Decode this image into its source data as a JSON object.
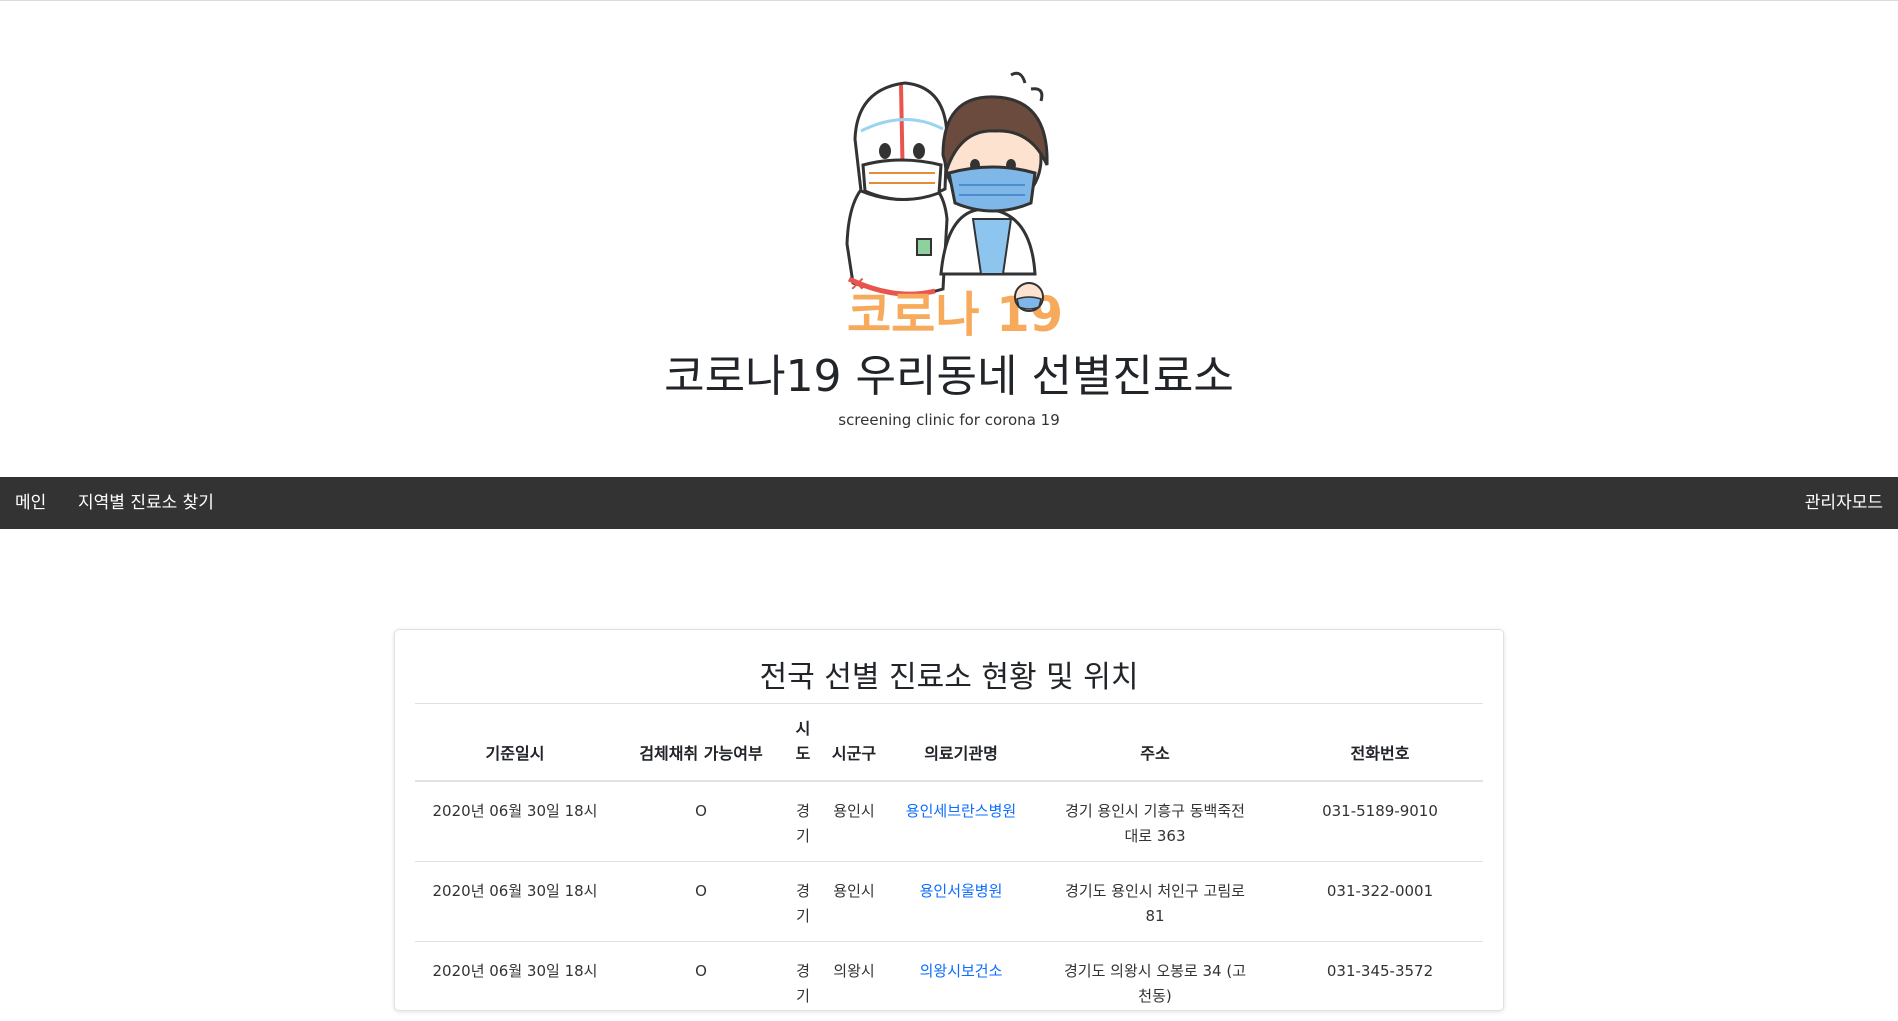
{
  "header": {
    "title": "코로나19 우리동네 선별진료소",
    "subtitle": "screening clinic for corona 19",
    "logo_text": "코로나 19"
  },
  "nav": {
    "items": [
      {
        "label": "메인"
      },
      {
        "label": "지역별 진료소 찾기"
      }
    ],
    "admin_label": "관리자모드"
  },
  "card": {
    "title": "전국 선별 진료소 현황 및 위치"
  },
  "table": {
    "headers": [
      "기준일시",
      "검체채취 가능여부",
      "시도",
      "시군구",
      "의료기관명",
      "주소",
      "전화번호"
    ],
    "rows": [
      {
        "date": "2020년 06월 30일 18시",
        "testing": "O",
        "sido": "경기",
        "sigungu": "용인시",
        "name": "용인세브란스병원",
        "address": "경기 용인시 기흥구 동백죽전대로 363",
        "phone": "031-5189-9010"
      },
      {
        "date": "2020년 06월 30일 18시",
        "testing": "O",
        "sido": "경기",
        "sigungu": "용인시",
        "name": "용인서울병원",
        "address": "경기도 용인시 처인구 고림로 81",
        "phone": "031-322-0001"
      },
      {
        "date": "2020년 06월 30일 18시",
        "testing": "O",
        "sido": "경기",
        "sigungu": "의왕시",
        "name": "의왕시보건소",
        "address": "경기도 의왕시 오봉로 34 (고천동)",
        "phone": "031-345-3572"
      }
    ]
  },
  "colors": {
    "navbar_bg": "#333333",
    "link": "#0d6efd",
    "logo_orange": "#f7a95c",
    "mask_blue": "#7fb7e8",
    "suit_red": "#e8554e"
  }
}
